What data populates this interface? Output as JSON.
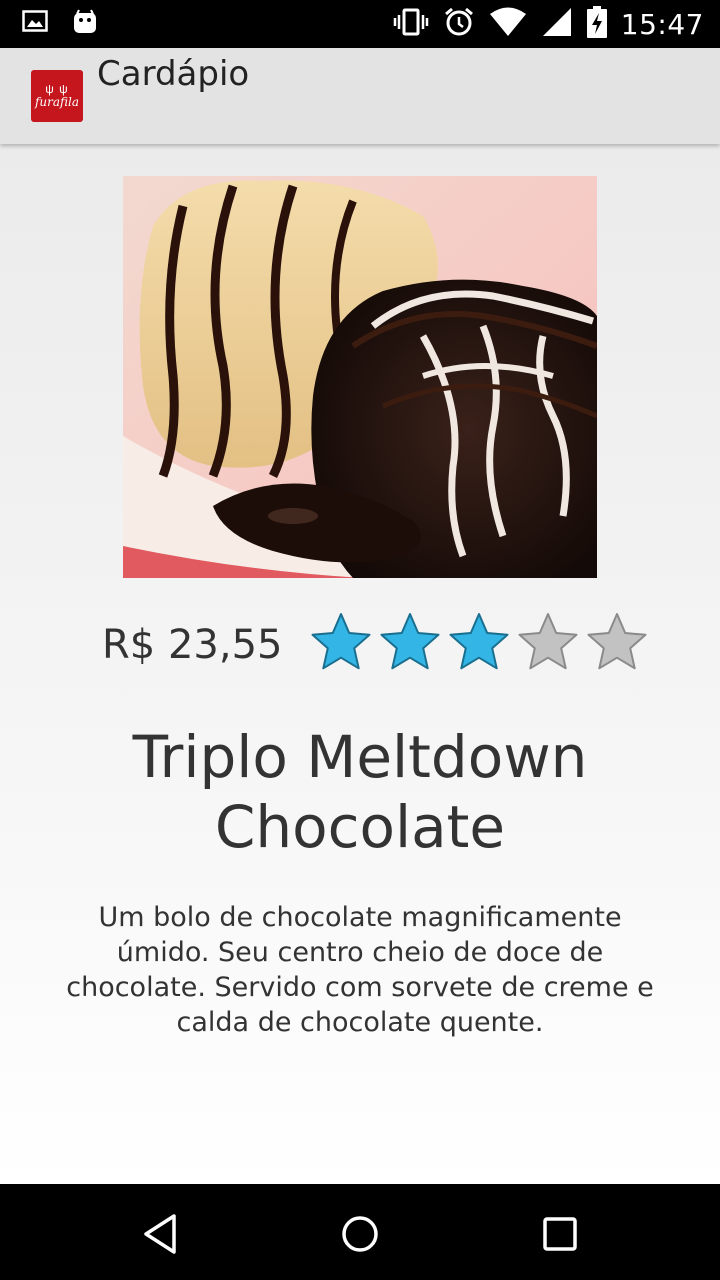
{
  "status_bar": {
    "time": "15:47",
    "left_icons": [
      "image-icon",
      "android-icon"
    ],
    "right_icons": [
      "vibrate-icon",
      "alarm-icon",
      "wifi-icon",
      "signal-icon",
      "battery-charging-icon"
    ]
  },
  "app_bar": {
    "logo_text": "furafila",
    "title": "Cardápio"
  },
  "product": {
    "image_alt": "Triplo Meltdown Chocolate",
    "price": "R$ 23,55",
    "rating": 3,
    "rating_max": 5,
    "name": "Triplo Meltdown Chocolate",
    "description": "Um bolo de chocolate magnificamente úmido. Seu centro cheio de doce de chocolate. Servido com sorvete de creme e calda de chocolate quente."
  },
  "colors": {
    "star_filled": "#33b5e5",
    "star_empty": "#c2c2c2",
    "logo_bg": "#c4161c",
    "app_bar_bg": "#e3e3e3"
  },
  "nav_bar": {
    "icons": [
      "back-icon",
      "home-icon",
      "recents-icon"
    ]
  }
}
